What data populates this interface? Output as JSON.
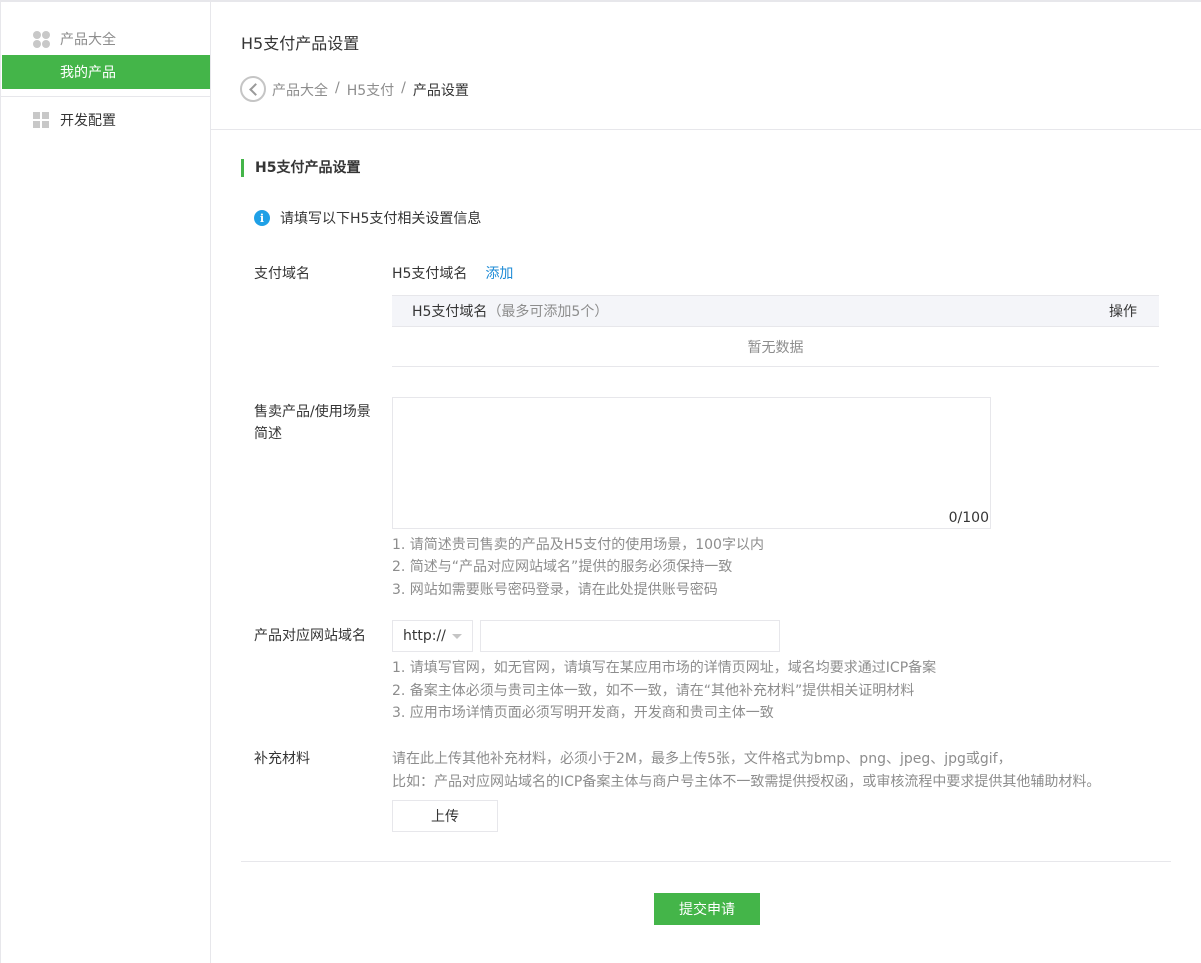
{
  "sidebar": {
    "products_group": "产品大全",
    "my_products": "我的产品",
    "dev_config": "开发配置"
  },
  "header": {
    "title": "H5支付产品设置",
    "breadcrumb": [
      "产品大全",
      "H5支付",
      "产品设置"
    ],
    "breadcrumb_sep": "/"
  },
  "form": {
    "section_title": "H5支付产品设置",
    "info_text": "请填写以下H5支付相关设置信息",
    "domain": {
      "label": "支付域名",
      "field_name": "H5支付域名",
      "add_link": "添加",
      "table_header": "H5支付域名",
      "table_header_sub": "（最多可添加5个）",
      "table_action": "操作",
      "empty_text": "暂无数据"
    },
    "description": {
      "label_line1": "售卖产品/使用场景",
      "label_line2": "简述",
      "value": "",
      "counter": "0/100",
      "hints": [
        "1. 请简述贵司售卖的产品及H5支付的使用场景，100字以内",
        "2. 简述与“产品对应网站域名”提供的服务必须保持一致",
        "3. 网站如需要账号密码登录，请在此处提供账号密码"
      ]
    },
    "website": {
      "label": "产品对应网站域名",
      "protocol": "http://",
      "value": "",
      "hints": [
        "1. 请填写官网，如无官网，请填写在某应用市场的详情页网址，域名均要求通过ICP备案",
        "2. 备案主体必须与贵司主体一致，如不一致，请在“其他补充材料”提供相关证明材料",
        "3. 应用市场详情页面必须写明开发商，开发商和贵司主体一致"
      ]
    },
    "materials": {
      "label": "补充材料",
      "hint_line1": "请在此上传其他补充材料，必须小于2M，最多上传5张，文件格式为bmp、png、jpeg、jpg或gif，",
      "hint_line2": "比如：产品对应网站域名的ICP备案主体与商户号主体不一致需提供授权函，或审核流程中要求提供其他辅助材料。",
      "upload_label": "上传"
    },
    "submit_label": "提交申请"
  },
  "colors": {
    "accent": "#44b549",
    "link": "#1e8bd6",
    "info": "#1fa0e6"
  }
}
